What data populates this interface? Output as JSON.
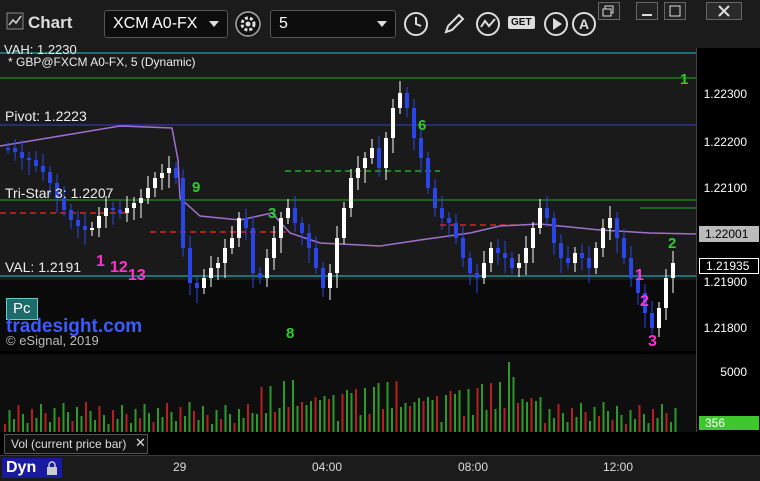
{
  "app": {
    "title": "Chart",
    "symbol": "XCM A0-FX",
    "interval": "5",
    "brand": "tradesight.com",
    "copyright": "© eSignal, 2019",
    "study_label": "* GBP@FXCM A0-FX, 5 (Dynamic)",
    "partial_top_label": "VAH: 1.2230",
    "pc_label": "Pc",
    "volume_label": "Vol (current price bar)",
    "dyn_label": "Dyn"
  },
  "toolbar": {
    "icons": [
      "chart-icon",
      "settings-gear-icon",
      "clock-icon",
      "pencil-icon",
      "trend-icon",
      "get-icon",
      "play-icon",
      "alert-icon"
    ],
    "get_label": "GET"
  },
  "window_buttons": [
    "restore",
    "minimize",
    "maximize",
    "close"
  ],
  "levels": [
    {
      "label": "Pivot: 1.2223",
      "color": "#3a3ad8"
    },
    {
      "label": "Tri-Star 3: 1.2207",
      "color": "#e02020"
    },
    {
      "label": "VAL: 1.2191",
      "color": "#20c8d0"
    }
  ],
  "price_axis": {
    "ticks": [
      "1.22300",
      "1.22200",
      "1.22100",
      "1.21900",
      "1.21800"
    ],
    "current_price": "1.22001",
    "last_price": "1.21935"
  },
  "volume_axis": {
    "ticks": [
      "5000"
    ],
    "current": "356"
  },
  "time_axis": [
    "29",
    "04:00",
    "08:00",
    "12:00"
  ],
  "counters": [
    {
      "text": "1",
      "color": "#ff33cc"
    },
    {
      "text": "12",
      "color": "#ff33cc"
    },
    {
      "text": "13",
      "color": "#ff33cc"
    },
    {
      "text": "1",
      "color": "#ff33cc"
    },
    {
      "text": "2",
      "color": "#ff33cc"
    },
    {
      "text": "3",
      "color": "#ff33cc"
    },
    {
      "text": "1",
      "color": "#2ecc2e"
    },
    {
      "text": "9",
      "color": "#2ecc2e"
    },
    {
      "text": "8",
      "color": "#2ecc2e"
    },
    {
      "text": "6",
      "color": "#2ecc2e"
    },
    {
      "text": "3",
      "color": "#2ecc2e"
    },
    {
      "text": "2",
      "color": "#2ecc2e"
    }
  ],
  "colors": {
    "up_candle": "#ffffff",
    "down_candle": "#2b46e8",
    "pivot": "#3a3ad8",
    "tristar": "#e02020",
    "val": "#20c8d0",
    "green_level": "#22aa22",
    "vwap": "#a070d0",
    "counter_pink": "#ff33cc",
    "counter_green": "#2ecc2e"
  }
}
